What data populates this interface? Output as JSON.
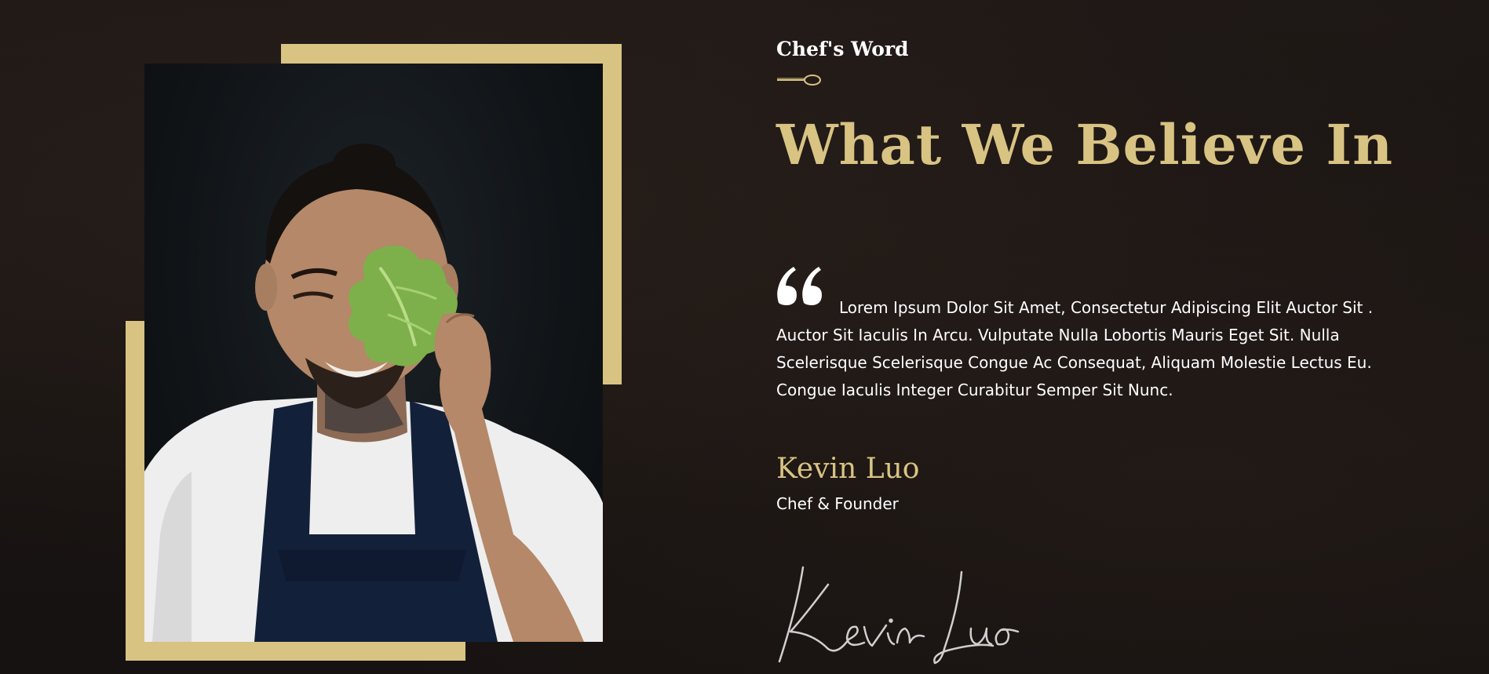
{
  "section": {
    "eyebrow": "Chef's Word",
    "heading": "What We Believe In",
    "quote": "Lorem Ipsum Dolor Sit Amet, Consectetur Adipiscing Elit Auctor Sit . Auctor Sit Iaculis In Arcu. Vulputate Nulla Lobortis Mauris Eget Sit. Nulla Scelerisque Scelerisque Congue Ac Consequat, Aliquam Molestie Lectus Eu. Congue Iaculis Integer Curabitur Semper Sit Nunc.",
    "author_name": "Kevin Luo",
    "author_role": "Chef & Founder",
    "signature_text": "Kevin Luo"
  },
  "icons": {
    "divider": "spoon-icon",
    "quote": "quote-mark-icon"
  },
  "colors": {
    "accent_gold": "#d8c383",
    "background": "#1b1614",
    "text": "#ffffff"
  }
}
